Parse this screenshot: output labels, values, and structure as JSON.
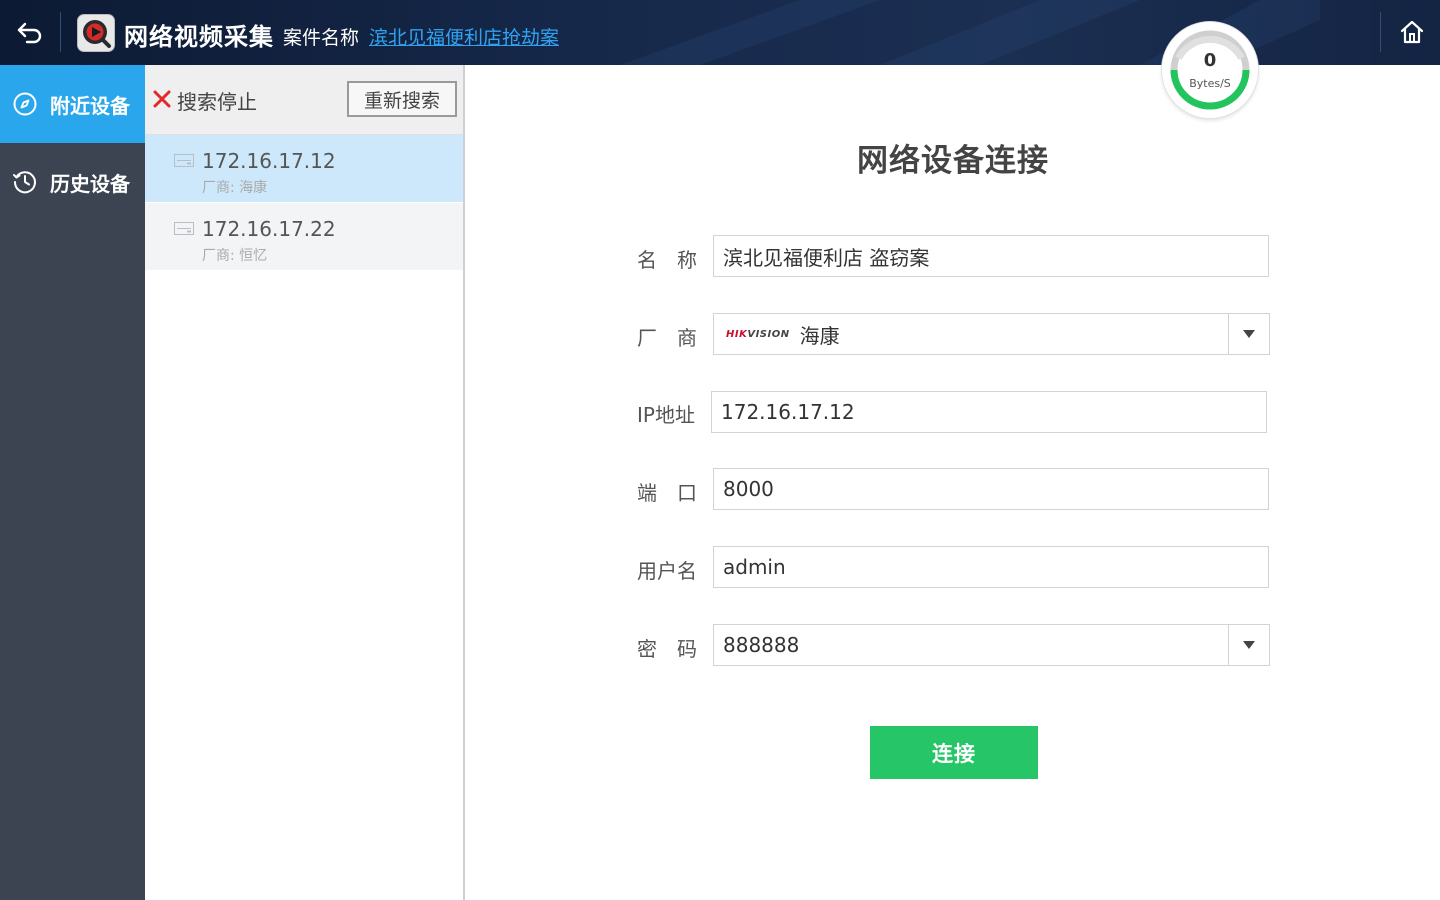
{
  "header": {
    "app_title": "网络视频采集",
    "case_label": "案件名称",
    "case_name": "滨北见福便利店抢劫案"
  },
  "sidebar": {
    "items": [
      {
        "label": "附近设备",
        "icon": "compass-icon",
        "active": true
      },
      {
        "label": "历史设备",
        "icon": "history-clock-icon",
        "active": false
      }
    ]
  },
  "device_panel": {
    "stop_label": "搜索停止",
    "research_label": "重新搜索",
    "devices": [
      {
        "ip": "172.16.17.12",
        "vendor": "厂商: 海康",
        "selected": true
      },
      {
        "ip": "172.16.17.22",
        "vendor": "厂商: 恒忆",
        "selected": false
      }
    ]
  },
  "speed": {
    "value": "0",
    "unit": "Bytes/S"
  },
  "form": {
    "title": "网络设备连接",
    "name_label": "名　称",
    "name_value": "滨北见福便利店 盗窃案",
    "vendor_label": "厂　商",
    "vendor_logo": "HIKVISION",
    "vendor_value": "海康",
    "ip_label": "IP地址",
    "ip_value": "172.16.17.12",
    "port_label": "端　口",
    "port_value": "8000",
    "user_label": "用户名",
    "user_value": "admin",
    "password_label": "密　码",
    "password_value": "888888",
    "connect_label": "连接"
  },
  "colors": {
    "accent": "#2aa7ec",
    "connect": "#26c567",
    "sidebar_bg": "#3c4451",
    "topbar_bg": "#16284a",
    "stop_red": "#e02a2a",
    "link": "#2ea3f2"
  }
}
